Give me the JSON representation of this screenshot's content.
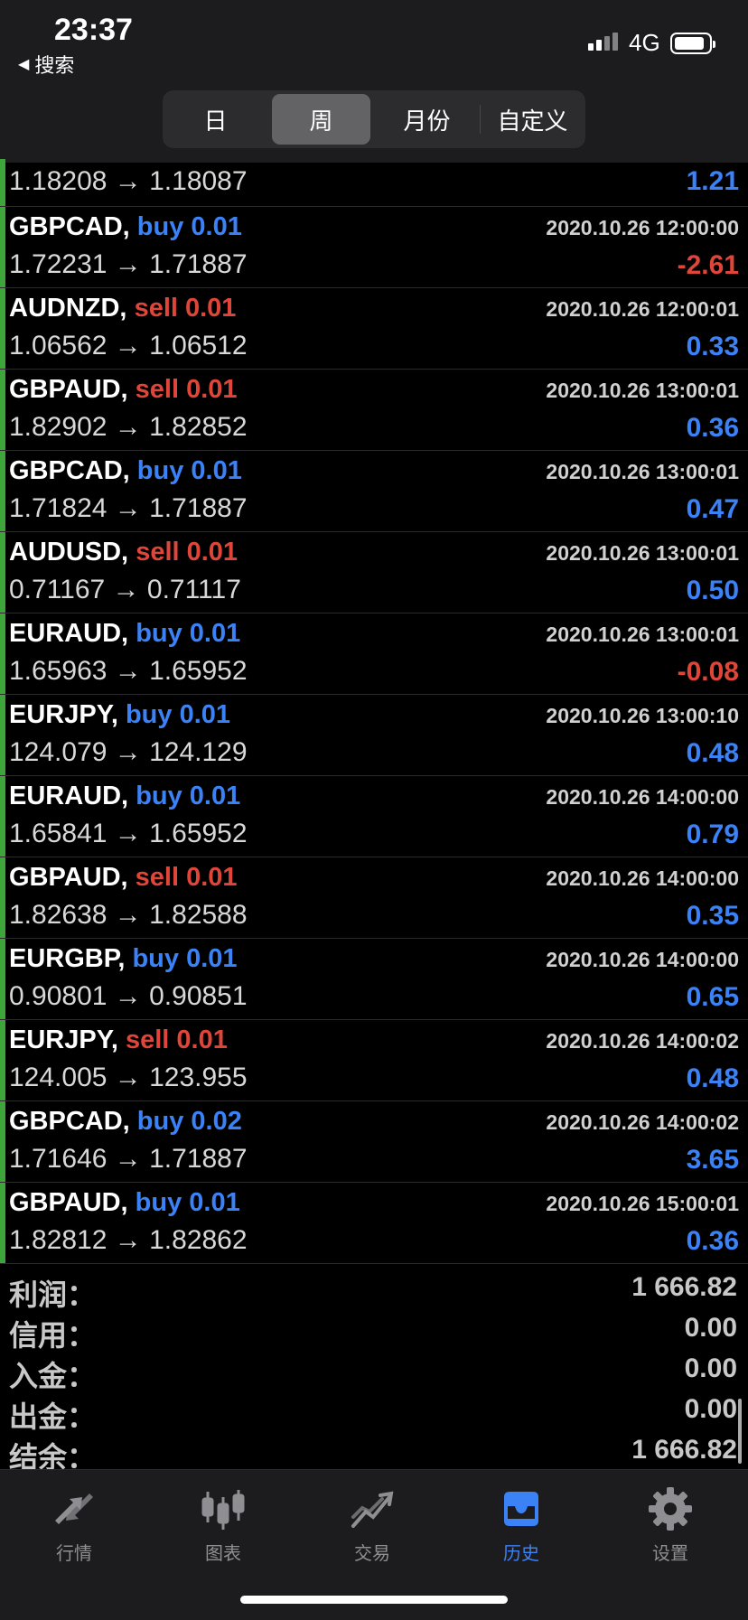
{
  "status_bar": {
    "time": "23:37",
    "back_label": "搜索",
    "network": "4G",
    "battery_level": 0.75
  },
  "segment": {
    "day": "日",
    "week": "周",
    "month": "月份",
    "custom": "自定义",
    "selected": "周"
  },
  "colors": {
    "buy": "#3b82f6",
    "sell": "#e0453a",
    "profit": "#3b82f6",
    "loss": "#e0453a",
    "accent": "#3b82f6"
  },
  "first_row": {
    "prices": "1.18208 → 1.18087",
    "profit": "1.21"
  },
  "trades": [
    {
      "symbol": "GBPCAD,",
      "side": "buy 0.01",
      "time": "2020.10.26 12:00:00",
      "prices": "1.72231 → 1.71887",
      "profit": "-2.61"
    },
    {
      "symbol": "AUDNZD,",
      "side": "sell 0.01",
      "time": "2020.10.26 12:00:01",
      "prices": "1.06562 → 1.06512",
      "profit": "0.33"
    },
    {
      "symbol": "GBPAUD,",
      "side": "sell 0.01",
      "time": "2020.10.26 13:00:01",
      "prices": "1.82902 → 1.82852",
      "profit": "0.36"
    },
    {
      "symbol": "GBPCAD,",
      "side": "buy 0.01",
      "time": "2020.10.26 13:00:01",
      "prices": "1.71824 → 1.71887",
      "profit": "0.47"
    },
    {
      "symbol": "AUDUSD,",
      "side": "sell 0.01",
      "time": "2020.10.26 13:00:01",
      "prices": "0.71167 → 0.71117",
      "profit": "0.50"
    },
    {
      "symbol": "EURAUD,",
      "side": "buy 0.01",
      "time": "2020.10.26 13:00:01",
      "prices": "1.65963 → 1.65952",
      "profit": "-0.08"
    },
    {
      "symbol": "EURJPY,",
      "side": "buy 0.01",
      "time": "2020.10.26 13:00:10",
      "prices": "124.079 → 124.129",
      "profit": "0.48"
    },
    {
      "symbol": "EURAUD,",
      "side": "buy 0.01",
      "time": "2020.10.26 14:00:00",
      "prices": "1.65841 → 1.65952",
      "profit": "0.79"
    },
    {
      "symbol": "GBPAUD,",
      "side": "sell 0.01",
      "time": "2020.10.26 14:00:00",
      "prices": "1.82638 → 1.82588",
      "profit": "0.35"
    },
    {
      "symbol": "EURGBP,",
      "side": "buy 0.01",
      "time": "2020.10.26 14:00:00",
      "prices": "0.90801 → 0.90851",
      "profit": "0.65"
    },
    {
      "symbol": "EURJPY,",
      "side": "sell 0.01",
      "time": "2020.10.26 14:00:02",
      "prices": "124.005 → 123.955",
      "profit": "0.48"
    },
    {
      "symbol": "GBPCAD,",
      "side": "buy 0.02",
      "time": "2020.10.26 14:00:02",
      "prices": "1.71646 → 1.71887",
      "profit": "3.65"
    },
    {
      "symbol": "GBPAUD,",
      "side": "buy 0.01",
      "time": "2020.10.26 15:00:01",
      "prices": "1.82812 → 1.82862",
      "profit": "0.36"
    }
  ],
  "summary": [
    {
      "label": "利润：",
      "value": "1 666.82"
    },
    {
      "label": "信用：",
      "value": "0.00"
    },
    {
      "label": "入金：",
      "value": "0.00"
    },
    {
      "label": "出金：",
      "value": "0.00"
    },
    {
      "label": "结余：",
      "value": "1 666.82"
    }
  ],
  "tabs": [
    {
      "label": "行情",
      "icon": "quotes-icon",
      "active": false
    },
    {
      "label": "图表",
      "icon": "chart-icon",
      "active": false
    },
    {
      "label": "交易",
      "icon": "trade-icon",
      "active": false
    },
    {
      "label": "历史",
      "icon": "history-icon",
      "active": true
    },
    {
      "label": "设置",
      "icon": "settings-icon",
      "active": false
    }
  ]
}
